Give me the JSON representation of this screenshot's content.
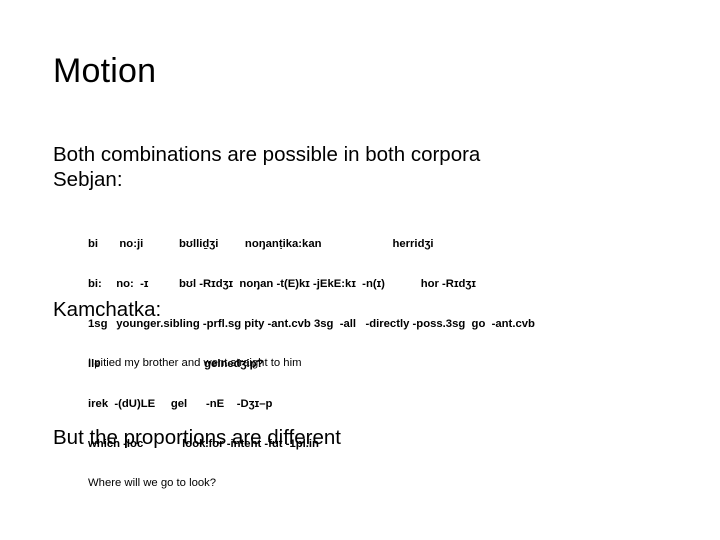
{
  "slide": {
    "title": "Motion",
    "background_color": "#ffffff",
    "text_color": "#000000",
    "body": {
      "intro_line_1": "Both combinations are possible in both corpora",
      "intro_line_2": "Sebjan:",
      "section_2_heading": "Kamchatka:",
      "closing_line": "But the proportions are different"
    },
    "sebjan_example": {
      "line_form": "bi\t  no:ji\t     bʊlliḏʒi\t  noŋanṭika:kan\t\t\t herridʒi",
      "line_segmentation": "bi:\t no:  -ɪ\t     bʊl -Rɪdʒɪ  noŋan -t(E)kɪ -jEkE:kɪ  -n(ɪ)\t\t  hor -Rɪdʒɪ",
      "line_gloss": "1sg\t younger.sibling -prfl.sg pity -ant.cvb 3sg  -all   -directly -poss.3sg  go  -ant.cvb",
      "line_translation": "I pitied my brother and went straight to him"
    },
    "kamchatka_example": {
      "line_form": "Ile\t\t\t\t     gelnedʒip?",
      "line_segmentation": "irek  -(dU)LE     gel      -nE    -Dʒɪ–p",
      "line_gloss": "which -loc\t      look.for -intent -fut -1pl.in",
      "line_translation": "Where will we go to look?"
    }
  }
}
